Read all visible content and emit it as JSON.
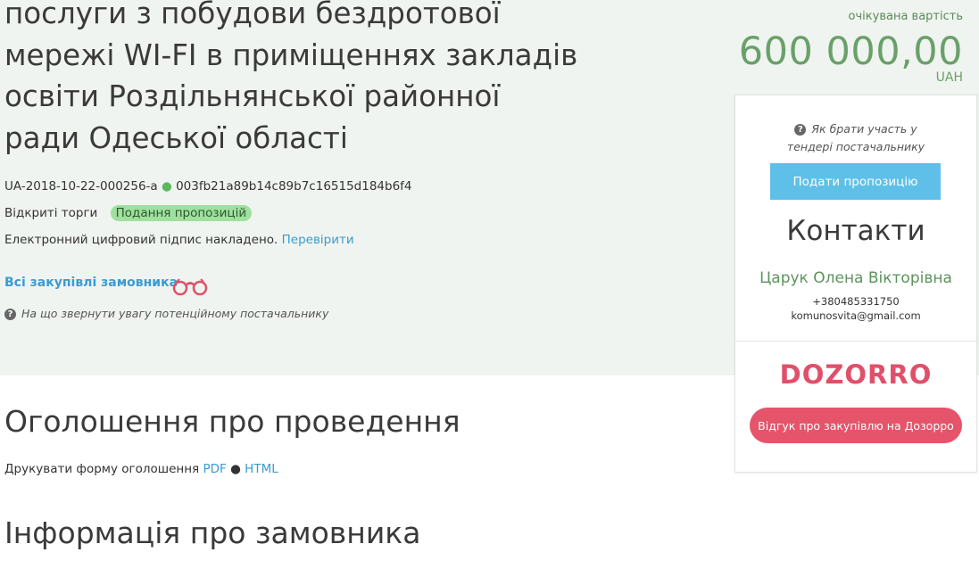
{
  "tender": {
    "title_lines": [
      "послуги з побудови бездротової",
      "мережі WI-FI в приміщеннях закладів",
      "освіти Роздільнянської районної",
      "ради Одеської області"
    ],
    "tender_id": "UA-2018-10-22-000256-a",
    "separator": "●",
    "hash": "003fb21a89b14c89b7c16515d184b6f4",
    "procurement_type": "Відкриті торги",
    "status": "Подання пропозицій",
    "signature_text": "Електронний цифровий підпис накладено.",
    "signature_link": "Перевірити",
    "all_purchases_link": "Всі закупівлі замовника",
    "attention_text": "На що звернути увагу потенційному постачальнику"
  },
  "estimate": {
    "label": "очікувана вартість",
    "value": "600 000,00",
    "currency": "UAH"
  },
  "sidebar": {
    "how_to_participate": "Як брати участь у тендері постачальнику",
    "submit_button": "Подати пропозицію",
    "contacts_heading": "Контакти",
    "contact_name": "Царук Олена Вікторівна",
    "contact_phone": "+380485331750",
    "contact_email": "komunosvita@gmail.com",
    "dozorro_logo_text": "DOZORRO",
    "dozorro_button": "Відгук про закупівлю на Дозорро"
  },
  "announcement": {
    "heading": "Оголошення про проведення",
    "print_label": "Друкувати форму оголошення",
    "pdf_link": "PDF",
    "separator": "●",
    "html_link": "HTML"
  },
  "customer": {
    "heading": "Інформація про замовника"
  },
  "colors": {
    "top_band": "#f0f4f0",
    "link": "#3a9bd1",
    "price_green": "#6aa06a",
    "submit_blue": "#5ec0e8",
    "dozorro_red": "#e5546b",
    "status_badge": "#9fdf9f"
  }
}
